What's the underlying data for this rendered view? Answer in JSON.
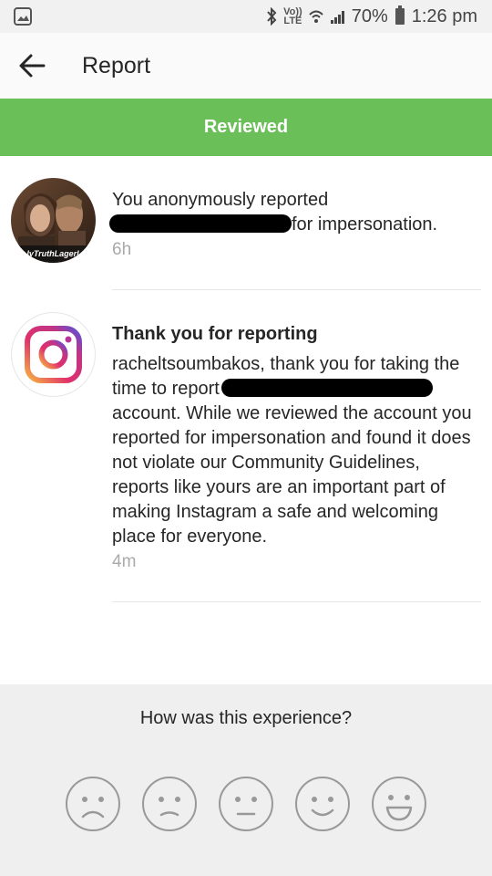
{
  "status_bar": {
    "left_icon": "photos-app-icon",
    "volte": "Vo)) LTE",
    "battery": "70%",
    "time": "1:26 pm"
  },
  "header": {
    "title": "Report"
  },
  "banner": {
    "label": "Reviewed"
  },
  "notifications": [
    {
      "avatar": "user-profile-photo",
      "line1": "You anonymously reported",
      "line2_suffix": "for impersonation.",
      "time": "6h",
      "avatar_caption": "lyTruthLagerl"
    },
    {
      "avatar": "instagram-logo",
      "title": "Thank you for reporting",
      "p1": "racheltsoumbakos, thank you for taking the",
      "p2_prefix": "time to report",
      "p3": "account. While we reviewed the account you reported for impersonation and found it does not violate our Community Guidelines, reports like yours are an important part of making Instagram a safe and welcoming place for everyone.",
      "time": "4m"
    }
  ],
  "feedback": {
    "question": "How was this experience?",
    "faces": [
      "very-sad-face-icon",
      "sad-face-icon",
      "neutral-face-icon",
      "smile-face-icon",
      "happy-face-icon"
    ]
  },
  "colors": {
    "banner": "#6bbf59",
    "divider": "#e6e6e6",
    "feedback_bg": "#efefef"
  }
}
